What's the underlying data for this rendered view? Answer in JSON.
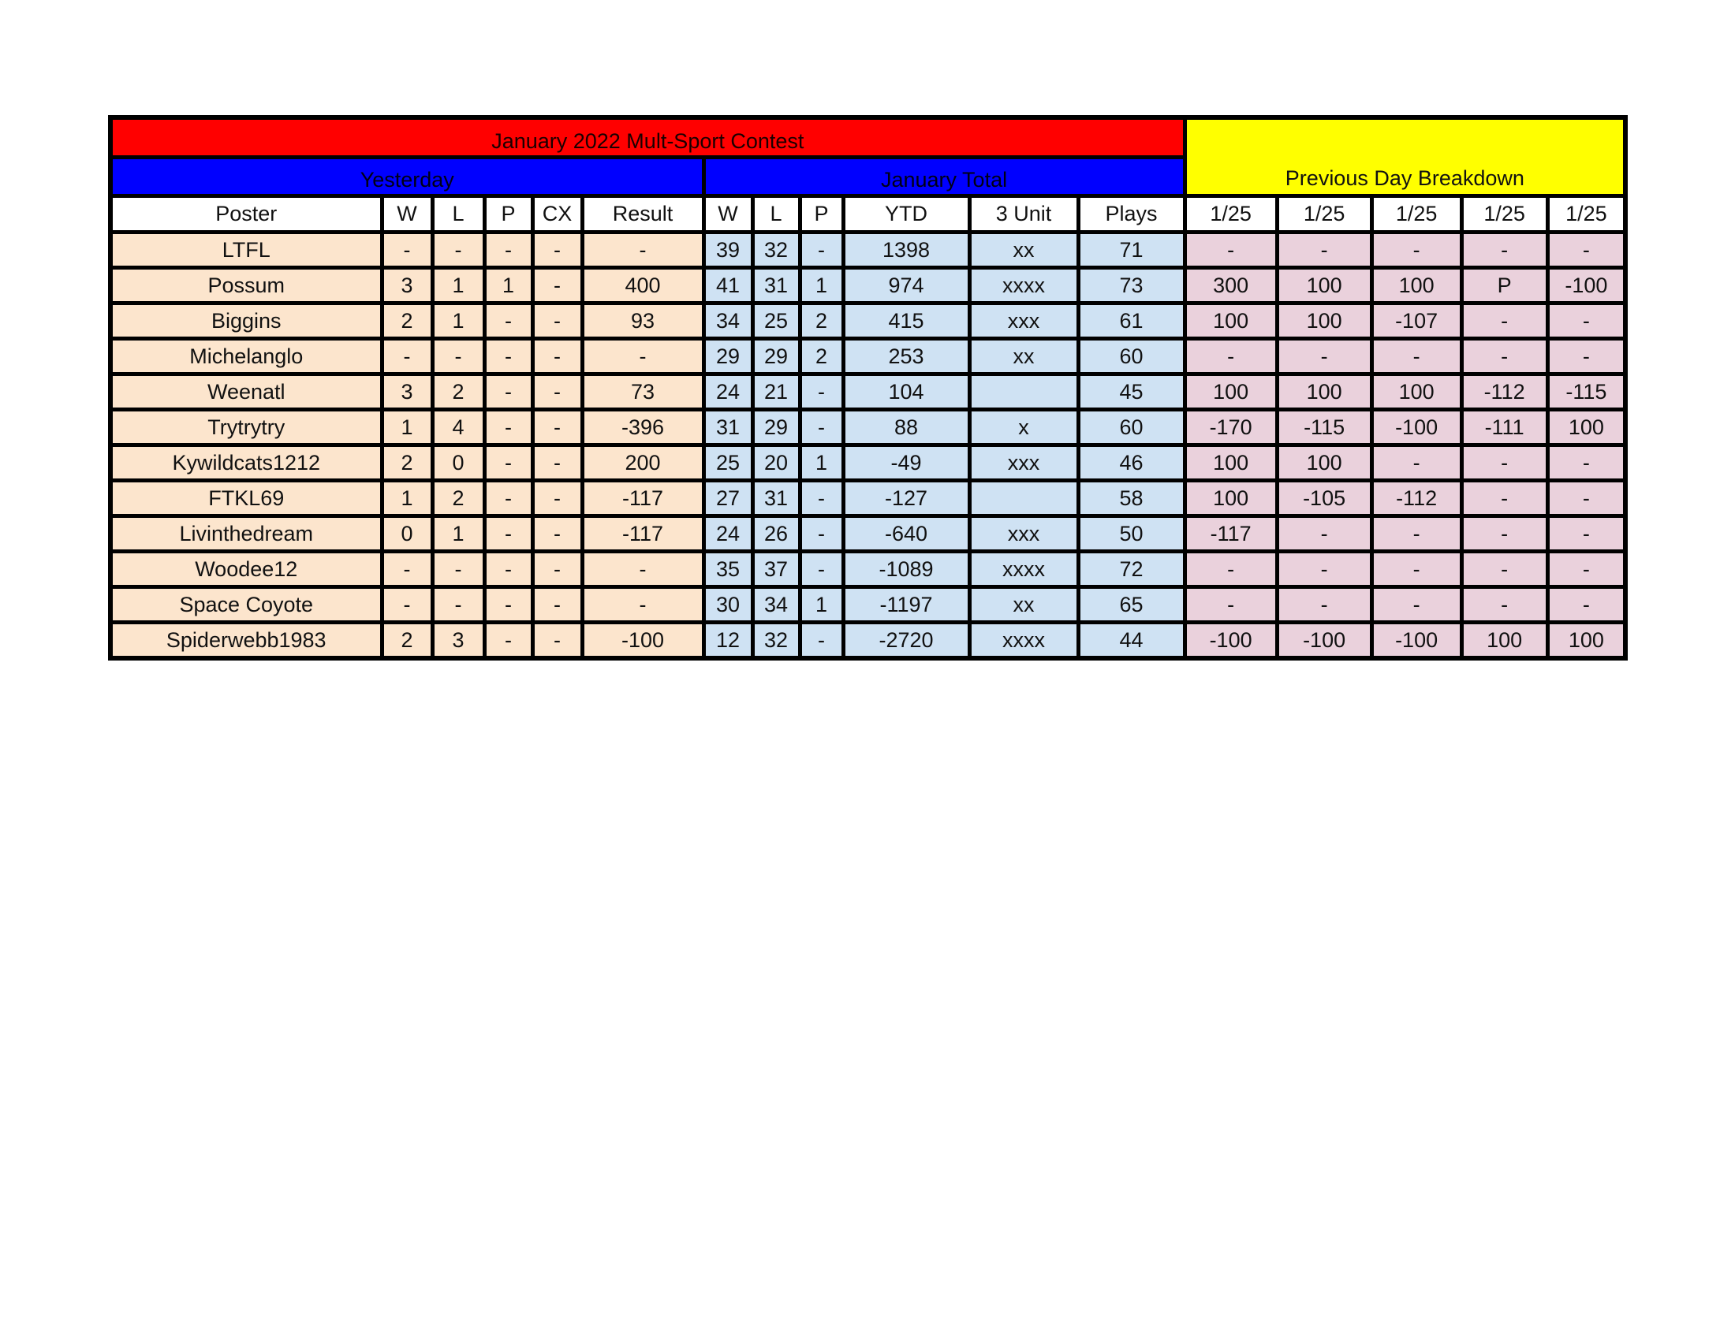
{
  "title": "January 2022 Mult-Sport Contest",
  "groups": {
    "yesterday": "Yesterday",
    "month_total": "January Total",
    "breakdown": "Previous Day Breakdown"
  },
  "colors": {
    "title_bg": "#ff0000",
    "group_bg": "#0000ff",
    "breakdown_bg": "#ffff00",
    "yesterday_cells": "#fce5cd",
    "total_cells": "#cfe2f3",
    "breakdown_cells": "#ead1dc"
  },
  "headers": [
    "Poster",
    "W",
    "L",
    "P",
    "CX",
    "Result",
    "W",
    "L",
    "P",
    "YTD",
    "3 Unit",
    "Plays",
    "1/25",
    "1/25",
    "1/25",
    "1/25",
    "1/25"
  ],
  "rows": [
    {
      "poster": "LTFL",
      "y_w": "-",
      "y_l": "-",
      "y_p": "-",
      "y_cx": "-",
      "y_result": "-",
      "t_w": "39",
      "t_l": "32",
      "t_p": "-",
      "ytd": "1398",
      "unit3": "xx",
      "plays": "71",
      "b": [
        "-",
        "-",
        "-",
        "-",
        "-"
      ]
    },
    {
      "poster": "Possum",
      "y_w": "3",
      "y_l": "1",
      "y_p": "1",
      "y_cx": "-",
      "y_result": "400",
      "t_w": "41",
      "t_l": "31",
      "t_p": "1",
      "ytd": "974",
      "unit3": "xxxx",
      "plays": "73",
      "b": [
        "300",
        "100",
        "100",
        "P",
        "-100"
      ]
    },
    {
      "poster": "Biggins",
      "y_w": "2",
      "y_l": "1",
      "y_p": "-",
      "y_cx": "-",
      "y_result": "93",
      "t_w": "34",
      "t_l": "25",
      "t_p": "2",
      "ytd": "415",
      "unit3": "xxx",
      "plays": "61",
      "b": [
        "100",
        "100",
        "-107",
        "-",
        "-"
      ]
    },
    {
      "poster": "Michelanglo",
      "y_w": "-",
      "y_l": "-",
      "y_p": "-",
      "y_cx": "-",
      "y_result": "-",
      "t_w": "29",
      "t_l": "29",
      "t_p": "2",
      "ytd": "253",
      "unit3": "xx",
      "plays": "60",
      "b": [
        "-",
        "-",
        "-",
        "-",
        "-"
      ]
    },
    {
      "poster": "Weenatl",
      "y_w": "3",
      "y_l": "2",
      "y_p": "-",
      "y_cx": "-",
      "y_result": "73",
      "t_w": "24",
      "t_l": "21",
      "t_p": "-",
      "ytd": "104",
      "unit3": "",
      "plays": "45",
      "b": [
        "100",
        "100",
        "100",
        "-112",
        "-115"
      ]
    },
    {
      "poster": "Trytrytry",
      "y_w": "1",
      "y_l": "4",
      "y_p": "-",
      "y_cx": "-",
      "y_result": "-396",
      "t_w": "31",
      "t_l": "29",
      "t_p": "-",
      "ytd": "88",
      "unit3": "x",
      "plays": "60",
      "b": [
        "-170",
        "-115",
        "-100",
        "-111",
        "100"
      ]
    },
    {
      "poster": "Kywildcats1212",
      "y_w": "2",
      "y_l": "0",
      "y_p": "-",
      "y_cx": "-",
      "y_result": "200",
      "t_w": "25",
      "t_l": "20",
      "t_p": "1",
      "ytd": "-49",
      "unit3": "xxx",
      "plays": "46",
      "b": [
        "100",
        "100",
        "-",
        "-",
        "-"
      ]
    },
    {
      "poster": "FTKL69",
      "y_w": "1",
      "y_l": "2",
      "y_p": "-",
      "y_cx": "-",
      "y_result": "-117",
      "t_w": "27",
      "t_l": "31",
      "t_p": "-",
      "ytd": "-127",
      "unit3": "",
      "plays": "58",
      "b": [
        "100",
        "-105",
        "-112",
        "-",
        "-"
      ]
    },
    {
      "poster": "Livinthedream",
      "y_w": "0",
      "y_l": "1",
      "y_p": "-",
      "y_cx": "-",
      "y_result": "-117",
      "t_w": "24",
      "t_l": "26",
      "t_p": "-",
      "ytd": "-640",
      "unit3": "xxx",
      "plays": "50",
      "b": [
        "-117",
        "-",
        "-",
        "-",
        "-"
      ]
    },
    {
      "poster": "Woodee12",
      "y_w": "-",
      "y_l": "-",
      "y_p": "-",
      "y_cx": "-",
      "y_result": "-",
      "t_w": "35",
      "t_l": "37",
      "t_p": "-",
      "ytd": "-1089",
      "unit3": "xxxx",
      "plays": "72",
      "b": [
        "-",
        "-",
        "-",
        "-",
        "-"
      ]
    },
    {
      "poster": "Space Coyote",
      "y_w": "-",
      "y_l": "-",
      "y_p": "-",
      "y_cx": "-",
      "y_result": "-",
      "t_w": "30",
      "t_l": "34",
      "t_p": "1",
      "ytd": "-1197",
      "unit3": "xx",
      "plays": "65",
      "b": [
        "-",
        "-",
        "-",
        "-",
        "-"
      ]
    },
    {
      "poster": "Spiderwebb1983",
      "y_w": "2",
      "y_l": "3",
      "y_p": "-",
      "y_cx": "-",
      "y_result": "-100",
      "t_w": "12",
      "t_l": "32",
      "t_p": "-",
      "ytd": "-2720",
      "unit3": "xxxx",
      "plays": "44",
      "b": [
        "-100",
        "-100",
        "-100",
        "100",
        "100"
      ]
    }
  ]
}
